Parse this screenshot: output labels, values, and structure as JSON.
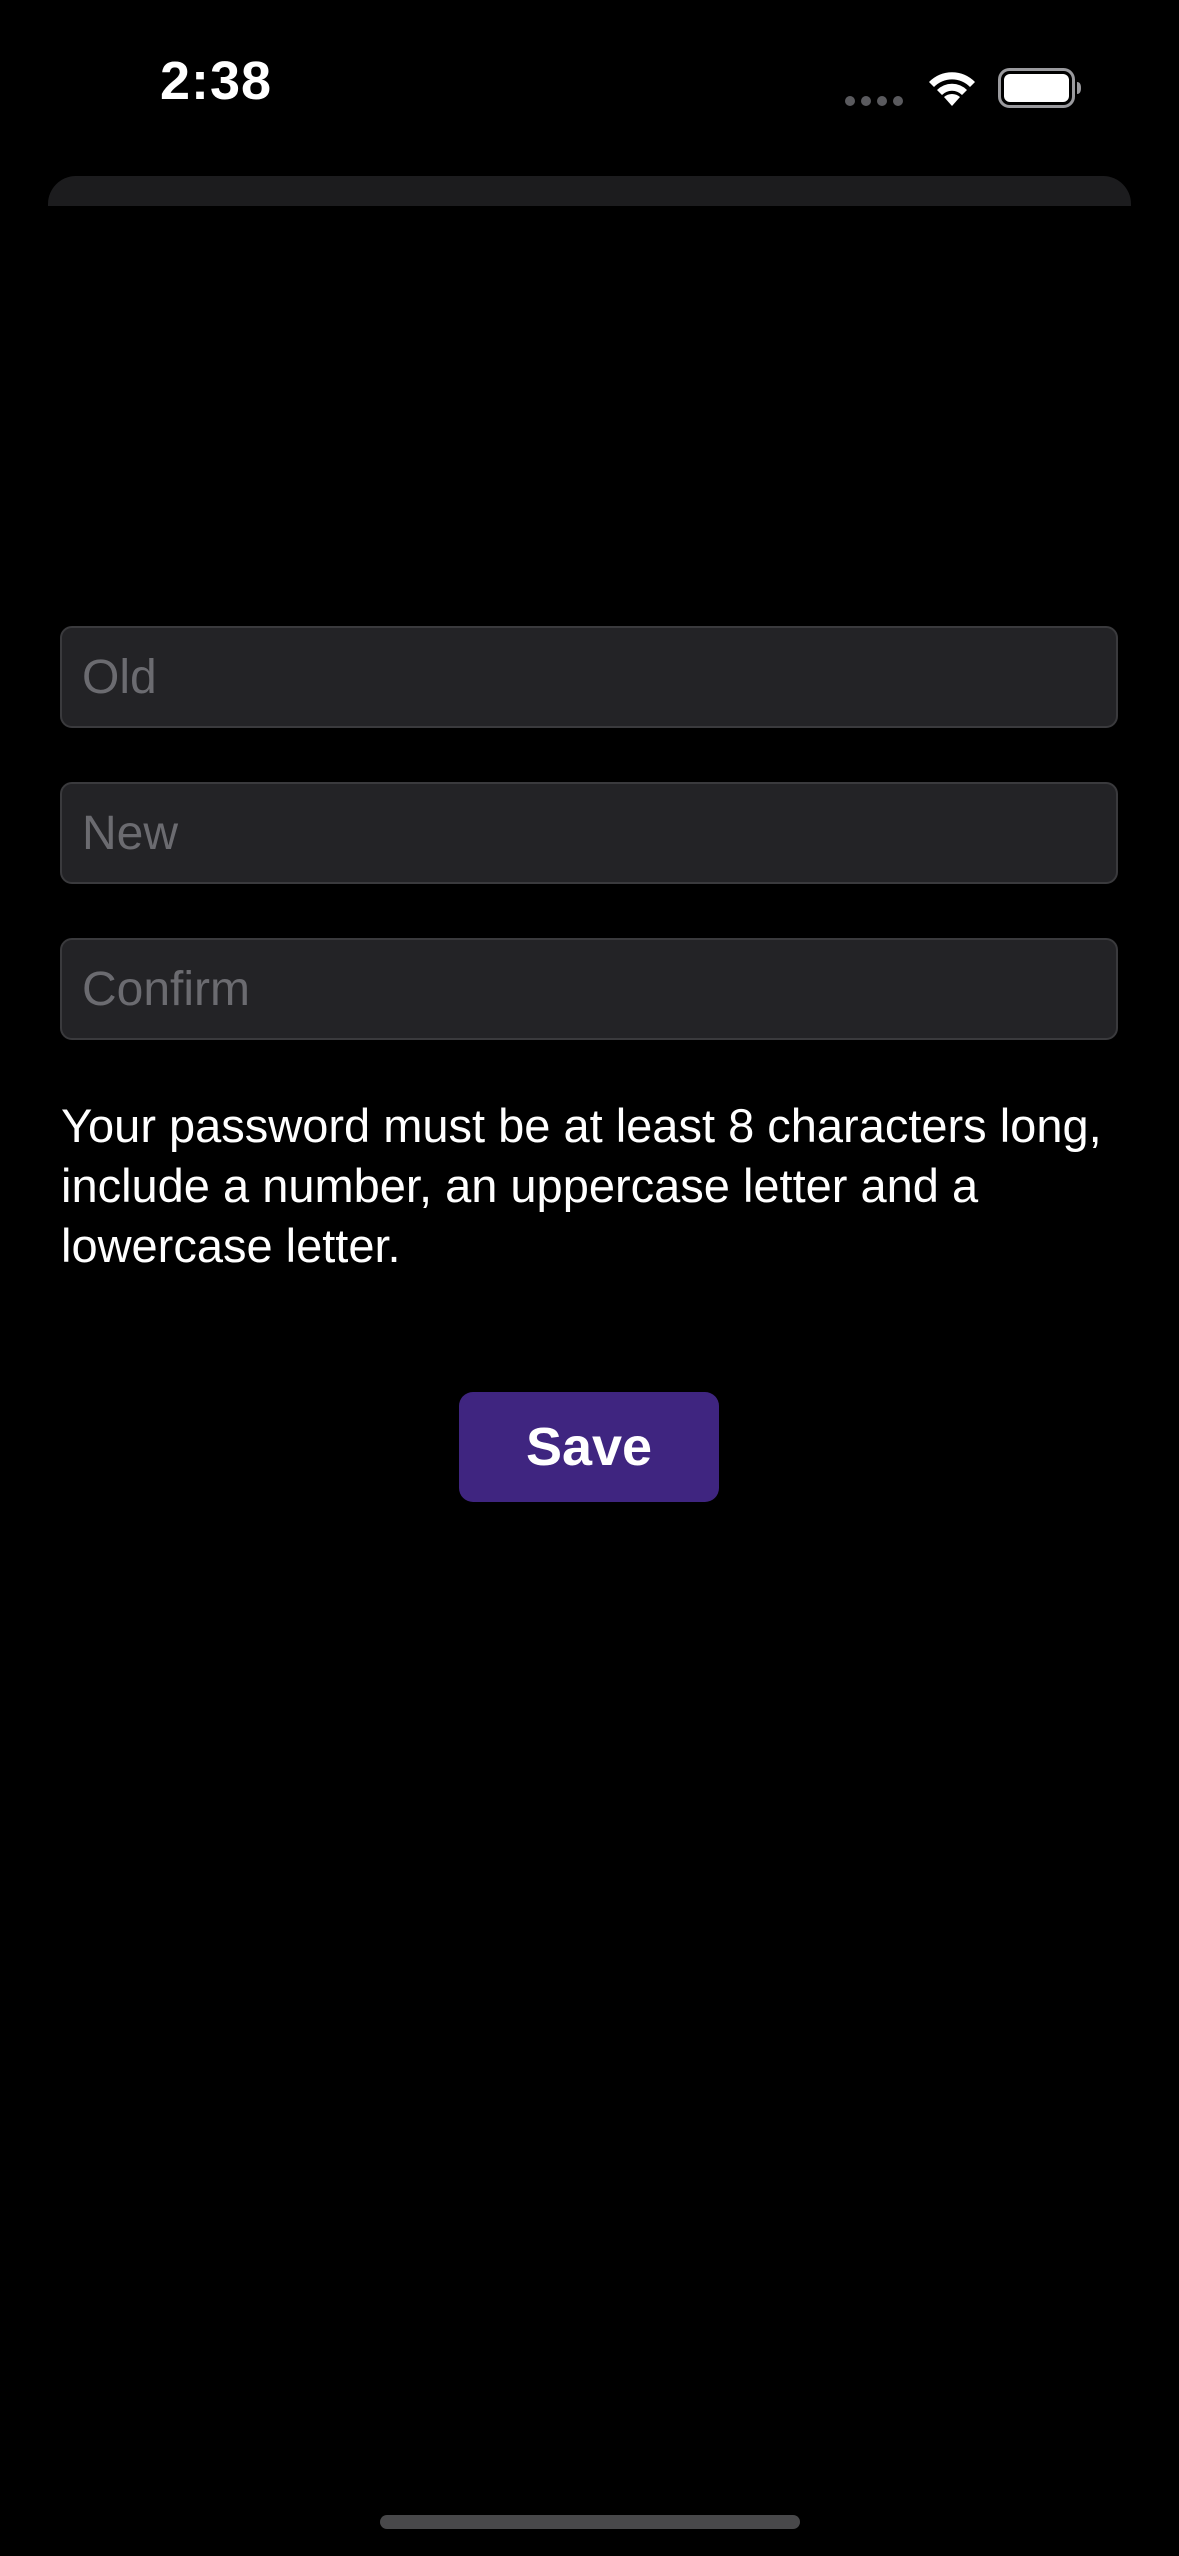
{
  "status_bar": {
    "time": "2:38"
  },
  "form": {
    "old_placeholder": "Old",
    "new_placeholder": "New",
    "confirm_placeholder": "Confirm",
    "old_value": "",
    "new_value": "",
    "confirm_value": ""
  },
  "hint": "Your password must be at least 8 characters long, include a number, an uppercase letter and a lowercase letter.",
  "save_label": "Save",
  "colors": {
    "background": "#000000",
    "field_background": "#232326",
    "placeholder": "#6b6b70",
    "button": "#3f2580",
    "text": "#ffffff"
  },
  "icons": {
    "signal": "cellular-signal-icon",
    "wifi": "wifi-icon",
    "battery": "battery-icon"
  }
}
